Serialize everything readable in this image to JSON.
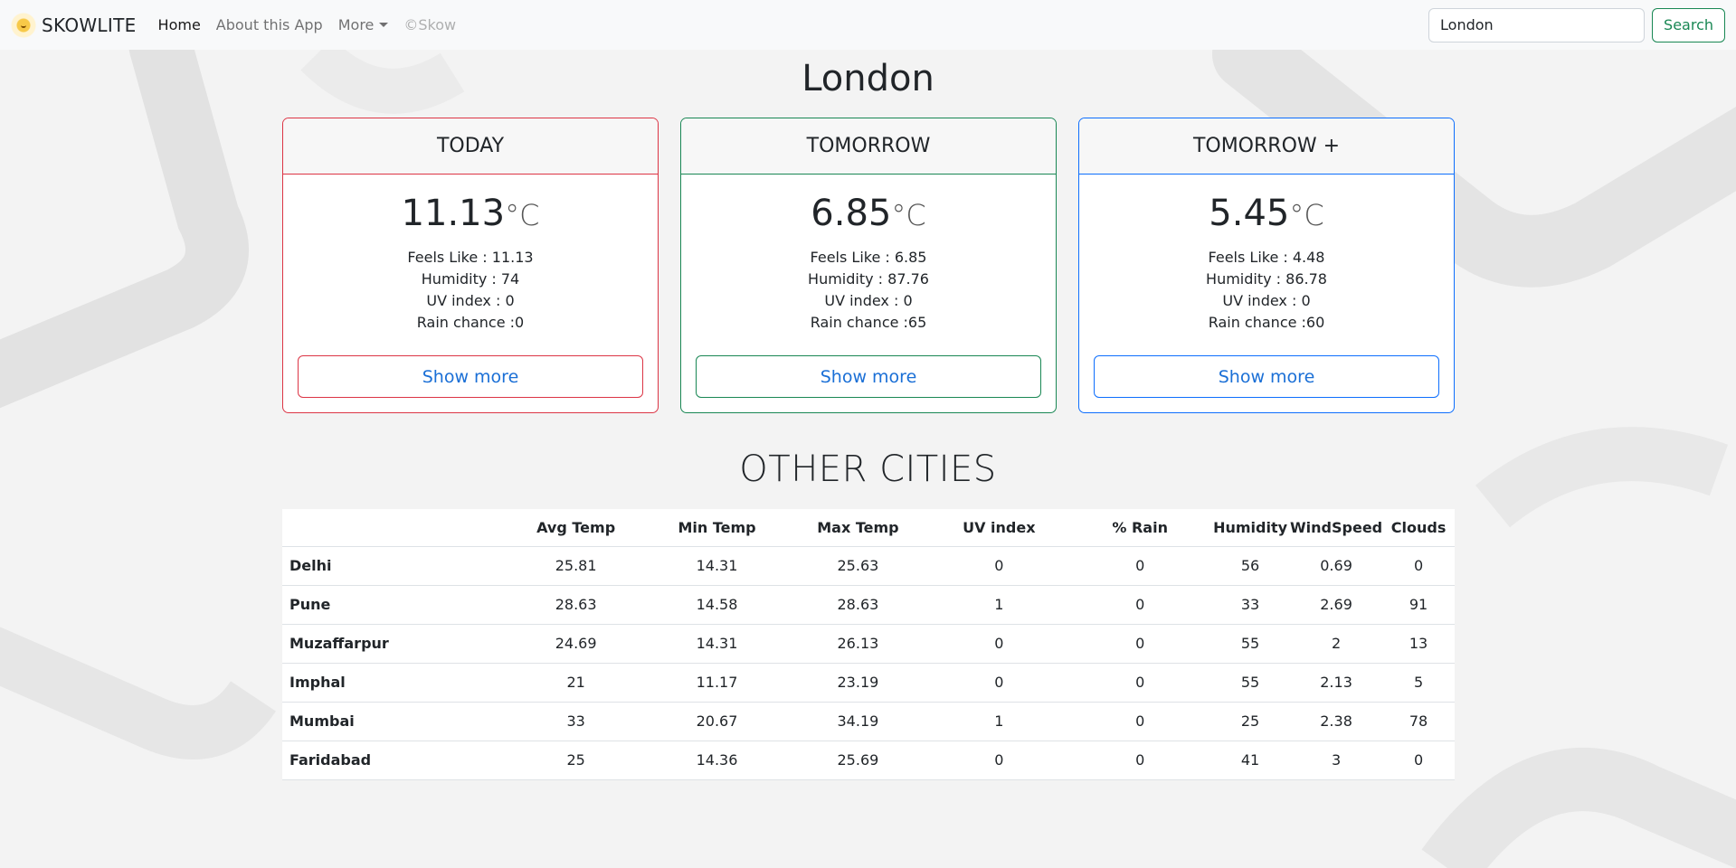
{
  "navbar": {
    "brand": "SKOWLITE",
    "links": [
      {
        "label": "Home"
      },
      {
        "label": "About this App"
      },
      {
        "label": "More"
      },
      {
        "label": "©Skow"
      }
    ],
    "search": {
      "value": "London",
      "placeholder": "Search"
    },
    "search_button": "Search"
  },
  "city": "London",
  "forecast": [
    {
      "title": "TODAY",
      "temp": "11.13",
      "unit": "°C",
      "feels_like": "Feels Like : 11.13",
      "humidity": "Humidity : 74",
      "uv": "UV index : 0",
      "rain": "Rain chance :0",
      "button": "Show more",
      "color": "#dc3545"
    },
    {
      "title": "TOMORROW",
      "temp": "6.85",
      "unit": "°C",
      "feels_like": "Feels Like : 6.85",
      "humidity": "Humidity : 87.76",
      "uv": "UV index : 0",
      "rain": "Rain chance :65",
      "button": "Show more",
      "color": "#198754"
    },
    {
      "title": "TOMORROW +",
      "temp": "5.45",
      "unit": "°C",
      "feels_like": "Feels Like : 4.48",
      "humidity": "Humidity : 86.78",
      "uv": "UV index : 0",
      "rain": "Rain chance :60",
      "button": "Show more",
      "color": "#0d6efd"
    }
  ],
  "other_cities": {
    "title": "OTHER CITIES",
    "headers": [
      "",
      "Avg Temp",
      "Min Temp",
      "Max Temp",
      "UV index",
      "% Rain",
      "Humidity",
      "WindSpeed",
      "Clouds"
    ],
    "rows": [
      [
        "Delhi",
        "25.81",
        "14.31",
        "25.63",
        "0",
        "0",
        "56",
        "0.69",
        "0"
      ],
      [
        "Pune",
        "28.63",
        "14.58",
        "28.63",
        "1",
        "0",
        "33",
        "2.69",
        "91"
      ],
      [
        "Muzaffarpur",
        "24.69",
        "14.31",
        "26.13",
        "0",
        "0",
        "55",
        "2",
        "13"
      ],
      [
        "Imphal",
        "21",
        "11.17",
        "23.19",
        "0",
        "0",
        "55",
        "2.13",
        "5"
      ],
      [
        "Mumbai",
        "33",
        "20.67",
        "34.19",
        "1",
        "0",
        "25",
        "2.38",
        "78"
      ],
      [
        "Faridabad",
        "25",
        "14.36",
        "25.69",
        "0",
        "0",
        "41",
        "3",
        "0"
      ]
    ]
  }
}
